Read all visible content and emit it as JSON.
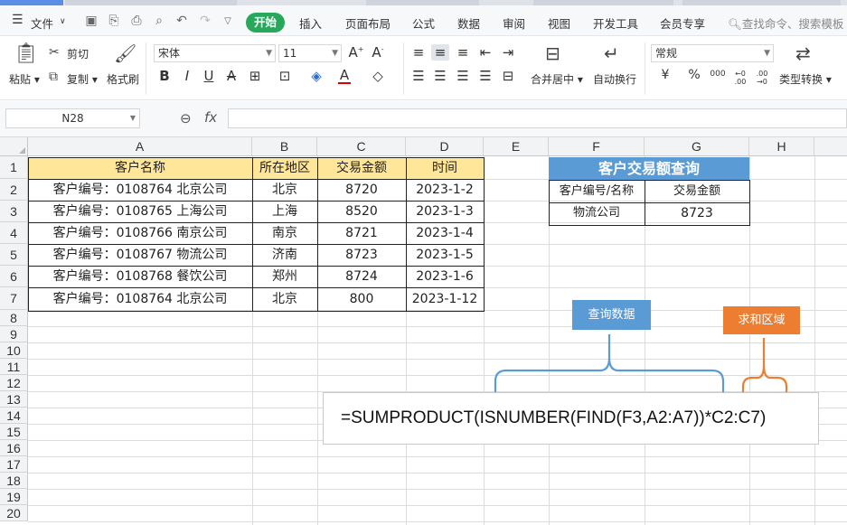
{
  "menu": {
    "file_label": "文件",
    "tabs": [
      "开始",
      "插入",
      "页面布局",
      "公式",
      "数据",
      "审阅",
      "视图",
      "开发工具",
      "会员专享"
    ],
    "active_tab": "开始",
    "search_placeholder": "查找命令、搜索模板"
  },
  "ribbon": {
    "paste": "粘贴",
    "cut": "剪切",
    "copy": "复制",
    "format_painter": "格式刷",
    "font_name": "宋体",
    "font_size": "11",
    "merge_center": "合并居中",
    "wrap_text": "自动换行",
    "number_format": "常规",
    "type_convert": "类型转换",
    "currency_symbol": "¥",
    "percent_symbol": "%",
    "thousands_symbol": "000",
    "inc_decimal": "←0 .00",
    "dec_decimal": ".00 →0"
  },
  "formula_bar": {
    "name_box": "N28",
    "fx_label": "fx",
    "content": ""
  },
  "columns": [
    "A",
    "B",
    "C",
    "D",
    "E",
    "F",
    "G",
    "H"
  ],
  "rows": [
    "1",
    "2",
    "3",
    "4",
    "5",
    "6",
    "7",
    "8",
    "9",
    "10",
    "11",
    "12",
    "13",
    "14",
    "15",
    "16",
    "17",
    "18",
    "19",
    "20"
  ],
  "table": {
    "headers": [
      "客户名称",
      "所在地区",
      "交易金额",
      "时间"
    ],
    "rows": [
      [
        "客户编号：0108764 北京公司",
        "北京",
        "8720",
        "2023-1-2"
      ],
      [
        "客户编号：0108765 上海公司",
        "上海",
        "8520",
        "2023-1-3"
      ],
      [
        "客户编号：0108766 南京公司",
        "南京",
        "8721",
        "2023-1-4"
      ],
      [
        "客户编号：0108767 物流公司",
        "济南",
        "8723",
        "2023-1-5"
      ],
      [
        "客户编号：0108768 餐饮公司",
        "郑州",
        "8724",
        "2023-1-6"
      ],
      [
        "客户编号：0108764 北京公司",
        "北京",
        "800",
        "2023-1-12"
      ]
    ]
  },
  "lookup": {
    "title": "客户交易额查询",
    "col1_header": "客户编号/名称",
    "col2_header": "交易金额",
    "query_value": "物流公司",
    "result_value": "8723"
  },
  "annotations": {
    "query_label": "查询数据",
    "sum_label": "求和区域",
    "formula": "=SUMPRODUCT(ISNUMBER(FIND(F3,A2:A7))*C2:C7)"
  },
  "colors": {
    "accent_green": "#27a85b",
    "header_yellow": "#ffe699",
    "lookup_blue": "#5b9bd5",
    "sum_orange": "#ed7d31"
  }
}
